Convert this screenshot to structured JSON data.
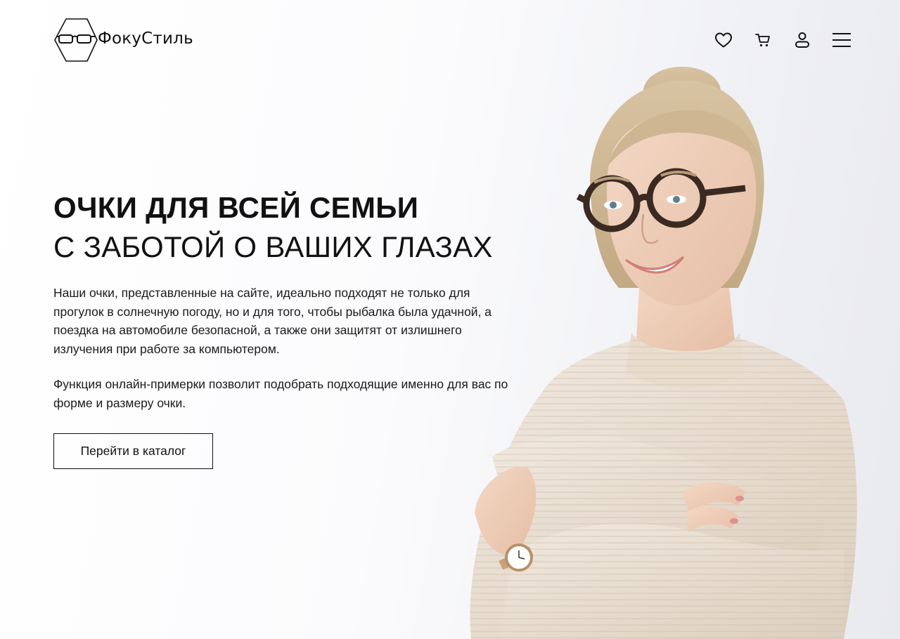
{
  "brand": {
    "name": "ФокуСтиль",
    "logo_icon": "glasses-hexagon-icon"
  },
  "nav": {
    "icons": [
      "heart-icon",
      "cart-icon",
      "user-icon",
      "menu-icon"
    ]
  },
  "hero": {
    "title": "ОЧКИ ДЛЯ ВСЕЙ СЕМЬИ",
    "subtitle": "С ЗАБОТОЙ О ВАШИХ ГЛАЗАХ",
    "paragraph1": "Наши очки, представленные на сайте, идеально подходят не только для прогулок в солнечную погоду, но и для того, чтобы рыбалка была удачной, а поездка на автомобиле безопасной, а также они защитят от излишнего излучения при работе за компьютером.",
    "paragraph2": "Функция онлайн-примерки позволит подобрать подходящие именно для вас по форме и размеру очки.",
    "cta_label": "Перейти в каталог"
  },
  "colors": {
    "text": "#111111",
    "background": "#ffffff",
    "sweater": "#eadfd2",
    "hair": "#cdb592",
    "frames": "#3a2a22"
  }
}
